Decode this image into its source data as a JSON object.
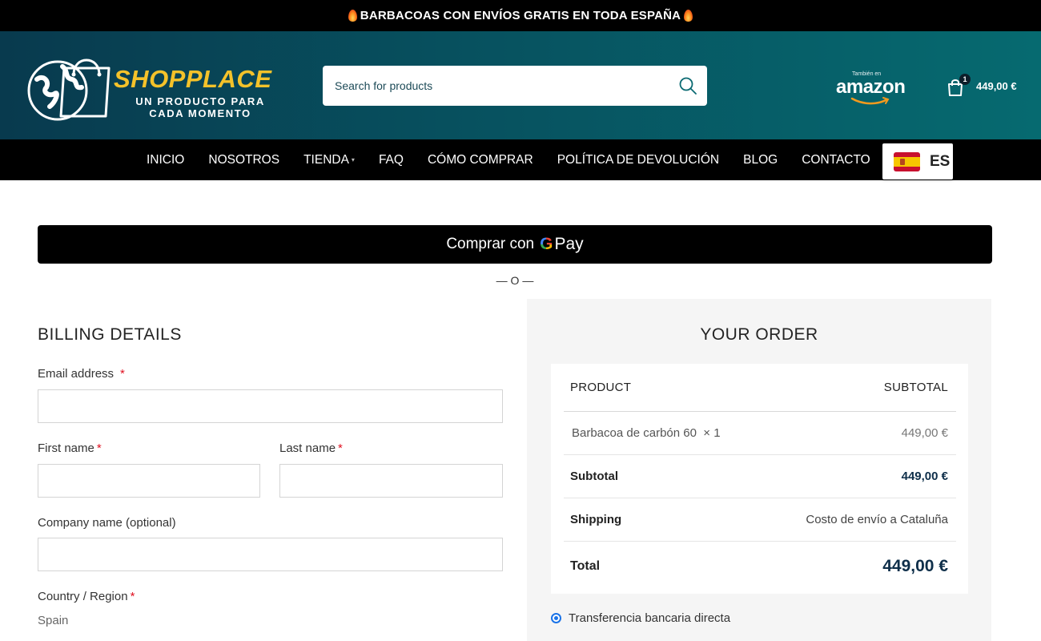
{
  "promo": {
    "text": "BARBACOAS CON ENVÍOS GRATIS EN TODA ESPAÑA"
  },
  "header": {
    "logo_word": "SHOPPLACE",
    "logo_tagline_1": "UN PRODUCTO PARA",
    "logo_tagline_2": "CADA MOMENTO",
    "search_placeholder": "Search for products",
    "amazon_small": "También en",
    "amazon_word": "amazon",
    "cart_count": "1",
    "cart_total": "449,00 €"
  },
  "nav": {
    "items": [
      "INICIO",
      "NOSOTROS",
      "TIENDA",
      "FAQ",
      "CÓMO COMPRAR",
      "POLÍTICA DE DEVOLUCIÓN",
      "BLOG",
      "CONTACTO"
    ],
    "lang_code": "ES"
  },
  "gpay": {
    "label": "Comprar con",
    "g": "G",
    "pay": "Pay"
  },
  "divider": "— O —",
  "billing": {
    "title": "BILLING DETAILS",
    "email_label": "Email address",
    "first_name_label": "First name",
    "last_name_label": "Last name",
    "company_label": "Company name (optional)",
    "country_label": "Country / Region",
    "country_value": "Spain",
    "required_mark": "*"
  },
  "order": {
    "title": "YOUR ORDER",
    "head_product": "PRODUCT",
    "head_subtotal": "SUBTOTAL",
    "item_name": "Barbacoa de carbón 60  × 1",
    "item_price": "449,00 €",
    "subtotal_label": "Subtotal",
    "subtotal_value": "449,00 €",
    "shipping_label": "Shipping",
    "shipping_value": "Costo de envío a Cataluña",
    "total_label": "Total",
    "total_value": "449,00 €",
    "payment_method": "Transferencia bancaria directa"
  },
  "colors": {
    "header_teal": "#066a70",
    "logo_yellow": "#f4c22a",
    "money_navy": "#0f2f4a",
    "required_red": "#e01020"
  }
}
